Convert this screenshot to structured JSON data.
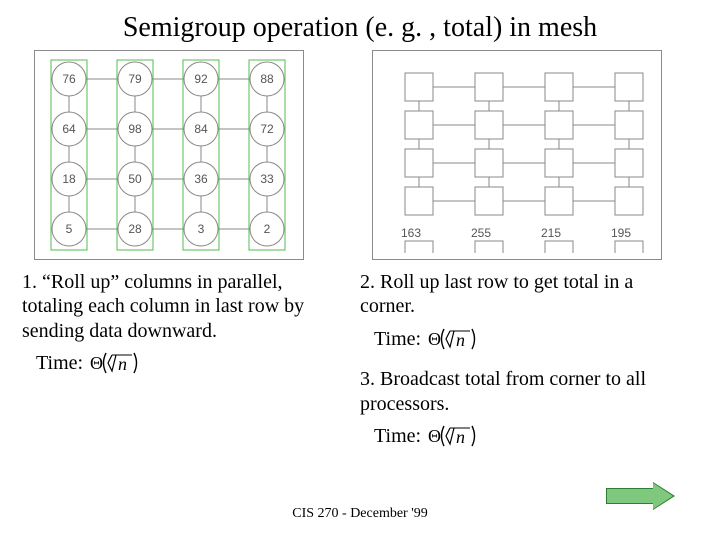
{
  "title": "Semigroup operation (e. g. , total) in mesh",
  "mesh1": {
    "rows": [
      [
        "76",
        "79",
        "92",
        "88"
      ],
      [
        "64",
        "98",
        "84",
        "72"
      ],
      [
        "18",
        "50",
        "36",
        "33"
      ],
      [
        "5",
        "28",
        "3",
        "2"
      ]
    ]
  },
  "mesh2": {
    "bottom": [
      "163",
      "255",
      "215",
      "195"
    ]
  },
  "steps": {
    "s1": "1. “Roll up” columns in parallel, totaling each column in last row by sending data downward.",
    "s1_time_label": "Time:",
    "s2": "2. Roll up last row to get total in a corner.",
    "s2_time_label": "Time:",
    "s3": "3. Broadcast total from corner to all processors.",
    "s3_time_label": "Time:"
  },
  "theta_expr": "Θ(√n)",
  "footer": "CIS 270 - December '99"
}
